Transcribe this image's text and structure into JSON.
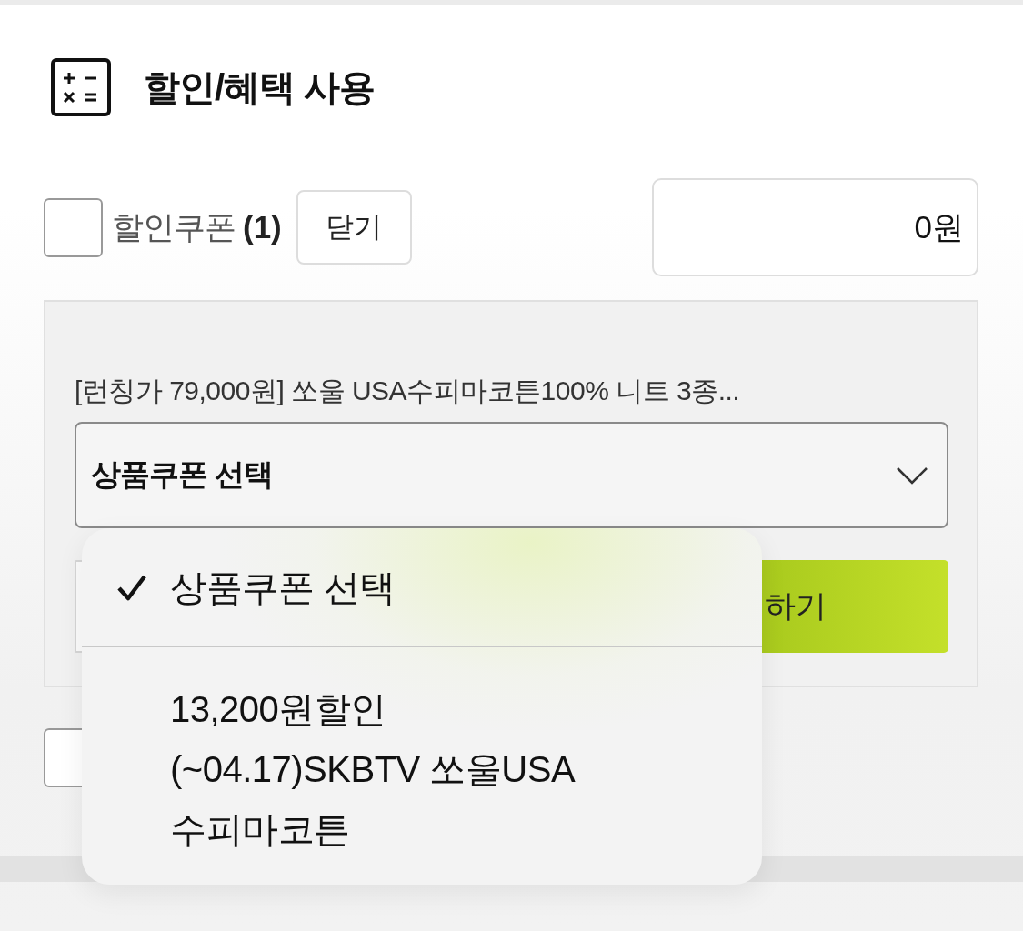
{
  "header": {
    "title": "할인/혜택 사용"
  },
  "coupon": {
    "checked": false,
    "label": "할인쿠폰",
    "count": "(1)",
    "close_button": "닫기",
    "amount": "0원"
  },
  "coupon_panel": {
    "product_name": "[런칭가 79,000원] 쏘울 USA수피마코튼100% 니트 3종...",
    "select": {
      "value": "상품쿠폰 선택",
      "expanded": true,
      "options": [
        {
          "lines": [
            "상품쿠폰 선택"
          ],
          "selected": true
        },
        {
          "lines": [
            "13,200원할인",
            "(~04.17)SKBTV 쏘울USA",
            "수피마코튼"
          ],
          "selected": false
        }
      ]
    },
    "apply_button": "하기"
  },
  "row_2": {
    "checked": false
  }
}
